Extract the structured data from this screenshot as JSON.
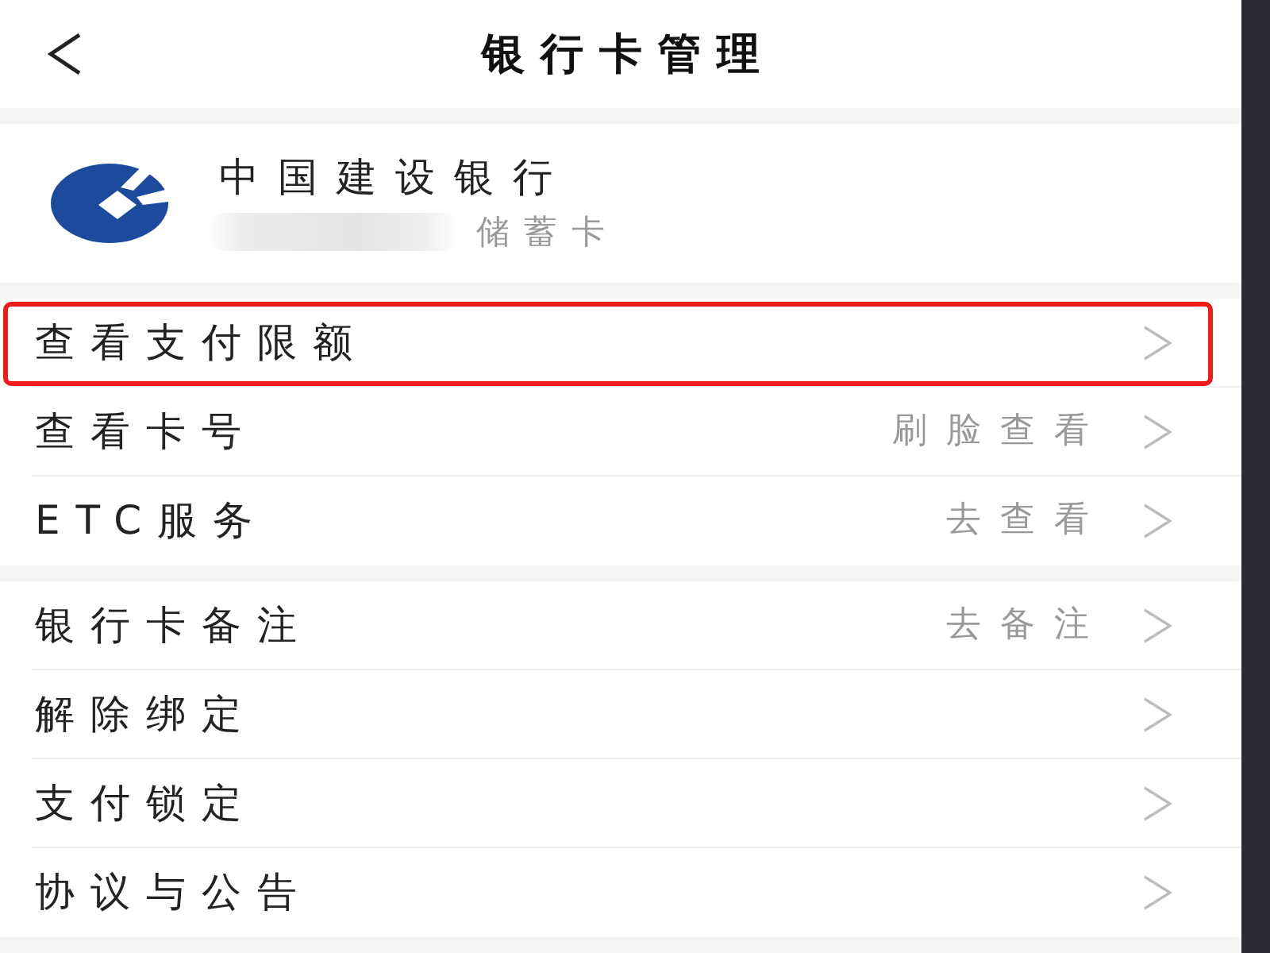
{
  "header": {
    "title": "银行卡管理"
  },
  "card": {
    "bank_name": "中国建设银行",
    "card_type": "储蓄卡"
  },
  "sections": [
    {
      "rows": [
        {
          "label": "查看支付限额",
          "highlighted": true
        },
        {
          "label": "查看卡号",
          "value": "刷脸查看",
          "highlighted": false
        },
        {
          "label": "ETC服务",
          "value": "去查看",
          "highlighted": false
        }
      ]
    },
    {
      "rows": [
        {
          "label": "银行卡备注",
          "value": "去备注",
          "highlighted": false
        },
        {
          "label": "解除绑定",
          "highlighted": false
        },
        {
          "label": "支付锁定",
          "highlighted": false
        },
        {
          "label": "协议与公告",
          "highlighted": false
        }
      ]
    }
  ]
}
